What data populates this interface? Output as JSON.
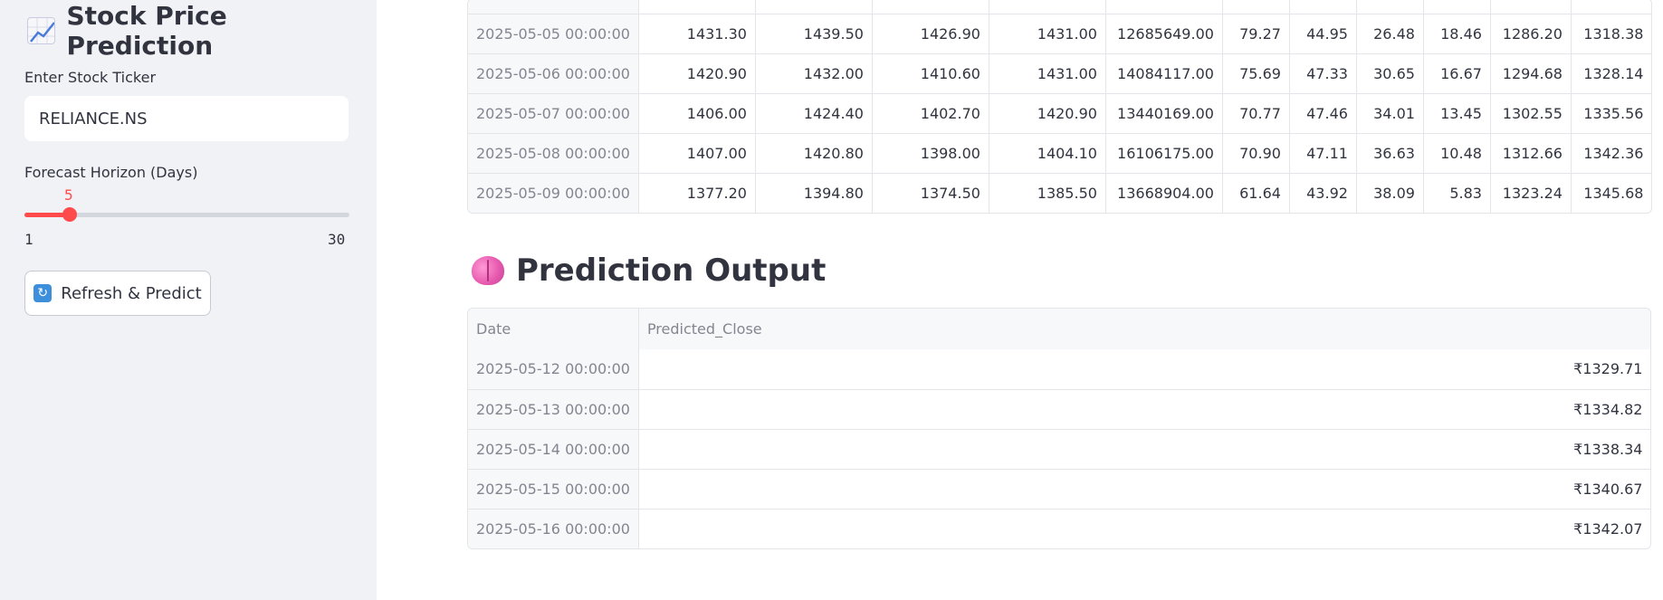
{
  "sidebar": {
    "title": "Stock Price Prediction",
    "ticker_label": "Enter Stock Ticker",
    "ticker_value": "RELIANCE.NS",
    "horizon_label": "Forecast Horizon (Days)",
    "horizon_value": "5",
    "horizon_min": "1",
    "horizon_max": "30",
    "horizon_fraction": 0.138,
    "predict_button_label": "Refresh & Predict",
    "icons": {
      "title": "chart-increasing-icon",
      "button": "refresh-icon"
    }
  },
  "history_table": {
    "rows": [
      {
        "date": "2025-05-05 00:00:00",
        "cells": [
          "1431.30",
          "1439.50",
          "1426.90",
          "1431.00",
          "12685649.00",
          "79.27",
          "44.95",
          "26.48",
          "18.46",
          "1286.20",
          "1318.38"
        ]
      },
      {
        "date": "2025-05-06 00:00:00",
        "cells": [
          "1420.90",
          "1432.00",
          "1410.60",
          "1431.00",
          "14084117.00",
          "75.69",
          "47.33",
          "30.65",
          "16.67",
          "1294.68",
          "1328.14"
        ]
      },
      {
        "date": "2025-05-07 00:00:00",
        "cells": [
          "1406.00",
          "1424.40",
          "1402.70",
          "1420.90",
          "13440169.00",
          "70.77",
          "47.46",
          "34.01",
          "13.45",
          "1302.55",
          "1335.56"
        ]
      },
      {
        "date": "2025-05-08 00:00:00",
        "cells": [
          "1407.00",
          "1420.80",
          "1398.00",
          "1404.10",
          "16106175.00",
          "70.90",
          "47.11",
          "36.63",
          "10.48",
          "1312.66",
          "1342.36"
        ]
      },
      {
        "date": "2025-05-09 00:00:00",
        "cells": [
          "1377.20",
          "1394.80",
          "1374.50",
          "1385.50",
          "13668904.00",
          "61.64",
          "43.92",
          "38.09",
          "5.83",
          "1323.24",
          "1345.68"
        ]
      }
    ]
  },
  "prediction": {
    "title": "Prediction Output",
    "icon": "brain-icon",
    "columns": [
      "Date",
      "Predicted_Close"
    ],
    "rows": [
      {
        "date": "2025-05-12 00:00:00",
        "value": "₹1329.71"
      },
      {
        "date": "2025-05-13 00:00:00",
        "value": "₹1334.82"
      },
      {
        "date": "2025-05-14 00:00:00",
        "value": "₹1338.34"
      },
      {
        "date": "2025-05-15 00:00:00",
        "value": "₹1340.67"
      },
      {
        "date": "2025-05-16 00:00:00",
        "value": "₹1342.07"
      }
    ]
  },
  "colors": {
    "accent": "#ff4b4b",
    "sidebar_bg": "#f0f2f6",
    "text": "#31333f",
    "muted": "#838590"
  }
}
